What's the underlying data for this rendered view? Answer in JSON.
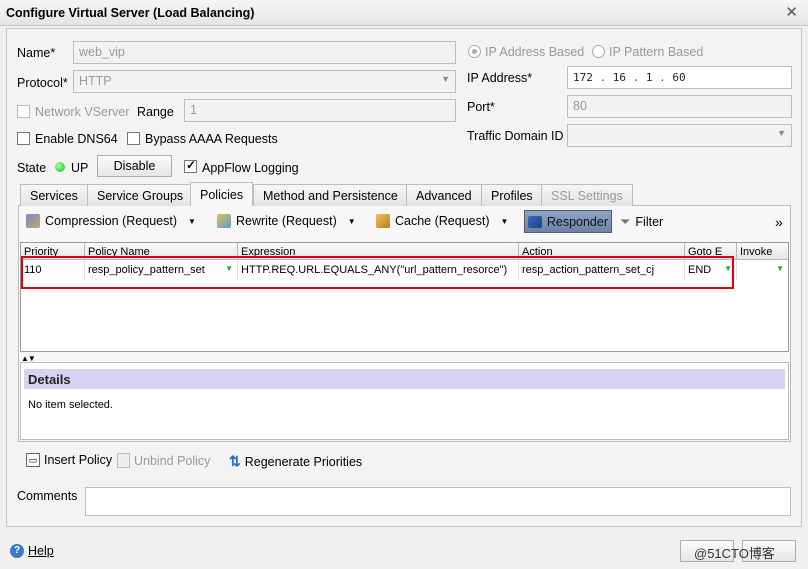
{
  "window": {
    "title": "Configure Virtual Server (Load Balancing)"
  },
  "form": {
    "name_label": "Name*",
    "name_value": "web_vip",
    "protocol_label": "Protocol*",
    "protocol_value": "HTTP",
    "network_vserver_label": "Network VServer",
    "range_label": "Range",
    "range_value": "1",
    "enable_dns64_label": "Enable DNS64",
    "bypass_aaaa_label": "Bypass AAAA Requests",
    "state_label": "State",
    "state_value": "UP",
    "disable_button": "Disable",
    "appflow_label": "AppFlow Logging",
    "ip_address_based": "IP Address Based",
    "ip_pattern_based": "IP Pattern Based",
    "ip_address_label": "IP Address*",
    "ip_octets": [
      "172",
      "16",
      "1",
      "60"
    ],
    "port_label": "Port*",
    "port_value": "80",
    "traffic_domain_label": "Traffic Domain ID",
    "traffic_domain_value": ""
  },
  "tabs": [
    "Services",
    "Service Groups",
    "Policies",
    "Method and Persistence",
    "Advanced",
    "Profiles",
    "SSL Settings"
  ],
  "toolbar": {
    "compression": "Compression (Request)",
    "rewrite": "Rewrite (Request)",
    "cache": "Cache (Request)",
    "responder": "Responder",
    "filter": "Filter",
    "more": "»"
  },
  "grid": {
    "headers": [
      "Priority",
      "Policy Name",
      "Expression",
      "Action",
      "Goto E",
      "Invoke"
    ],
    "rows": [
      {
        "priority": "110",
        "policy": "resp_policy_pattern_set",
        "expression": "HTTP.REQ.URL.EQUALS_ANY(\"url_pattern_resorce\")",
        "action": "resp_action_pattern_set_cj",
        "goto": "END",
        "invoke": ""
      }
    ]
  },
  "details": {
    "title": "Details",
    "message": "No item selected."
  },
  "actions": {
    "insert": "Insert Policy",
    "unbind": "Unbind Policy",
    "regenerate": "Regenerate Priorities"
  },
  "comments_label": "Comments",
  "footer": {
    "help": "Help",
    "watermark": "@51CTO博客"
  },
  "colors": {
    "accent": "#6a9be8",
    "highlight": "#e00010",
    "details_header": "#d6d2f2"
  }
}
